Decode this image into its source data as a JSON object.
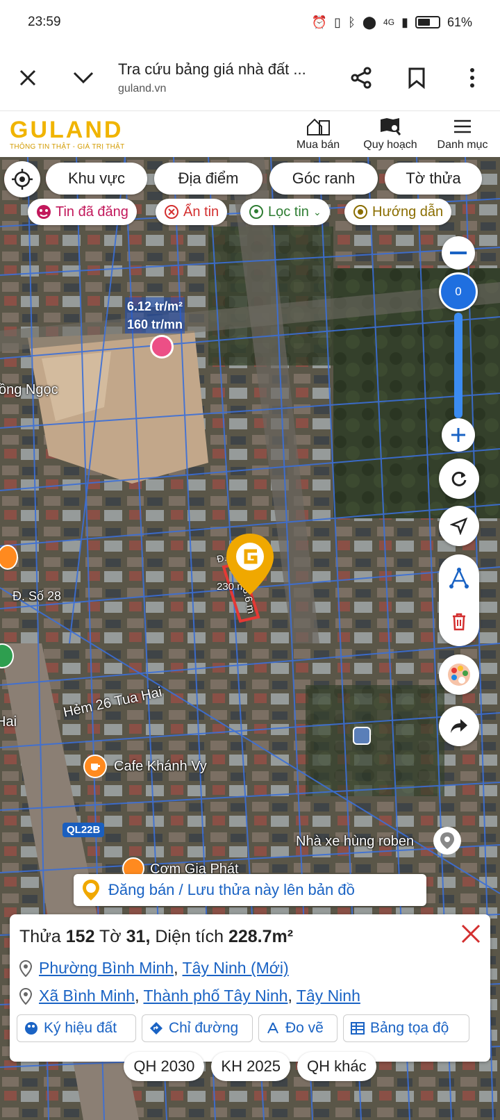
{
  "status_bar": {
    "time": "23:59",
    "battery": "61%",
    "battery_level": 0.61,
    "network": "4G"
  },
  "browser": {
    "title": "Tra cứu bảng giá nhà đất ...",
    "url": "guland.vn"
  },
  "site": {
    "logo": "GULAND",
    "tagline": "THÔNG TIN THẬT - GIÁ TRỊ THẬT",
    "nav": [
      {
        "label": "Mua bán",
        "icon": "house-icon"
      },
      {
        "label": "Quy hoạch",
        "icon": "map-search-icon"
      },
      {
        "label": "Danh mục",
        "icon": "menu-icon"
      }
    ]
  },
  "map": {
    "filters": [
      "Khu vực",
      "Địa điểm",
      "Góc ranh",
      "Tờ thửa"
    ],
    "chips": [
      {
        "label": "Tin đã đăng",
        "color": "#c2185b"
      },
      {
        "label": "Ẩn tin",
        "color": "#d32f2f"
      },
      {
        "label": "Lọc tin",
        "color": "#2e7d32"
      },
      {
        "label": "Hướng dẫn",
        "color": "#8a6d00"
      }
    ],
    "zoom_value": "0",
    "price": {
      "per_m2": "6.12 tr/m²",
      "total": "160 tr/mn"
    },
    "labels": {
      "street_1": "ồng Ngọc",
      "street_2": "Đ. Số 28",
      "alley": "Hẻm 26 Tua Hai",
      "side": "Hai",
      "cafe": "Cafe Khánh Vy",
      "road_badge": "QL22B",
      "bus": "Nhà xe hùng roben",
      "restaurant": "Cơm Gia Phát",
      "dim_1": "230 m",
      "dim_2": "33.6 m",
      "street_3": "Đ. S"
    },
    "banner": "Đăng bán / Lưu thửa này lên bản đồ"
  },
  "parcel": {
    "thua_label": "Thửa",
    "thua": "152",
    "to_label": "Tờ",
    "to": "31",
    "area_label": "Diện tích",
    "area": "228.7m²",
    "addr_new": {
      "ward": "Phường Bình Minh",
      "province": "Tây Ninh (Mới)"
    },
    "addr_old": {
      "ward": "Xã Bình Minh",
      "city": "Thành phố Tây Ninh",
      "province": "Tây Ninh"
    },
    "actions": [
      "Ký hiệu đất",
      "Chỉ đường",
      "Đo vẽ",
      "Bảng tọa độ"
    ]
  },
  "bottom_tabs": [
    "QH 2030",
    "KH 2025",
    "QH khác"
  ],
  "colors": {
    "brand": "#f0b400",
    "link": "#1a63c4",
    "plot_line": "#3b6fd8",
    "zoom": "#1f6fe0"
  }
}
